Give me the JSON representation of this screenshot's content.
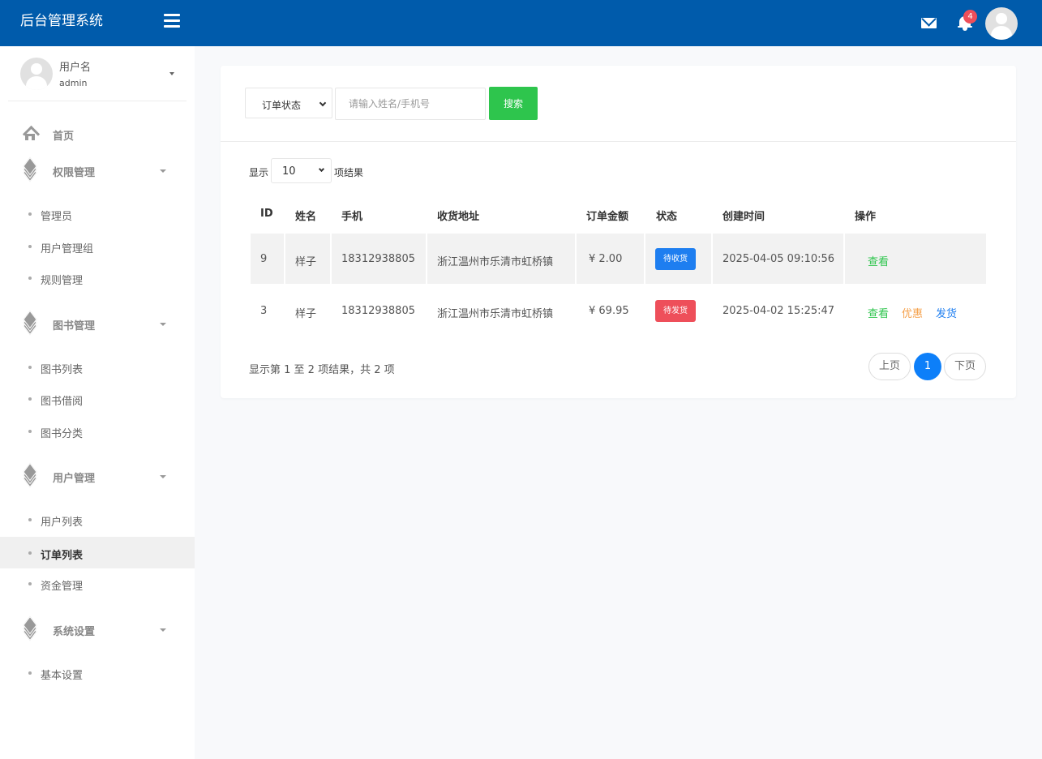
{
  "header": {
    "title": "后台管理系统",
    "notification_count": "4",
    "colors": {
      "bar": "#005bab"
    }
  },
  "sidebar": {
    "user": {
      "label": "用户名",
      "name": "admin"
    },
    "home": {
      "label": "首页",
      "icon": "home-icon"
    },
    "groups": [
      {
        "label": "权限管理",
        "icon": "layers-icon",
        "items": [
          "管理员",
          "用户管理组",
          "规则管理"
        ]
      },
      {
        "label": "图书管理",
        "icon": "layers-icon",
        "items": [
          "图书列表",
          "图书借阅",
          "图书分类"
        ]
      },
      {
        "label": "用户管理",
        "icon": "layers-icon",
        "items": [
          "用户列表",
          "订单列表",
          "资金管理"
        ]
      },
      {
        "label": "系统设置",
        "icon": "layers-icon",
        "items": [
          "基本设置"
        ]
      }
    ],
    "active_item": "订单列表"
  },
  "filters": {
    "status_select": "订单状态",
    "search_placeholder": "请输入姓名/手机号",
    "search_button": "搜索"
  },
  "table": {
    "page_size_prefix": "显示",
    "page_size": "10",
    "page_size_suffix": "项结果",
    "columns": [
      "ID",
      "姓名",
      "手机",
      "收货地址",
      "订单金额",
      "状态",
      "创建时间",
      "操作"
    ],
    "rows": [
      {
        "id": "9",
        "name": "样子",
        "phone": "18312938805",
        "address": "浙江温州市乐清市虹桥镇",
        "amount": "¥ 2.00",
        "status": "待收货",
        "status_color": "#1e7ef0",
        "created": "2025-04-05 09:10:56",
        "actions": [
          {
            "label": "查看",
            "color": "#2ec54d"
          }
        ]
      },
      {
        "id": "3",
        "name": "样子",
        "phone": "18312938805",
        "address": "浙江温州市乐清市虹桥镇",
        "amount": "¥ 69.95",
        "status": "待发货",
        "status_color": "#ee4f5a",
        "created": "2025-04-02 15:25:47",
        "actions": [
          {
            "label": "查看",
            "color": "#2ec54d"
          },
          {
            "label": "优惠",
            "color": "#f5a04a"
          },
          {
            "label": "发货",
            "color": "#1e7ef0"
          }
        ]
      }
    ],
    "summary": "显示第 1 至 2 项结果，共 2 项"
  },
  "pagination": {
    "prev": "上页",
    "current": "1",
    "next": "下页",
    "active_color": "#0d7ff9"
  }
}
